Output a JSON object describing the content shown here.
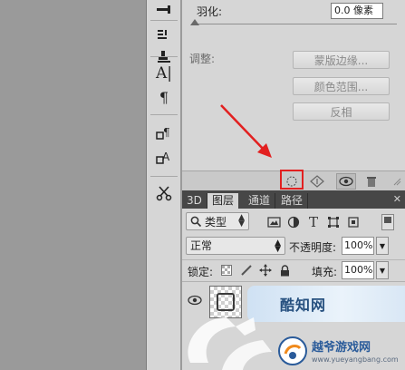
{
  "properties": {
    "feather_label": "羽化:",
    "feather_value": "0.0 像素",
    "adjust_label": "调整:",
    "buttons": [
      "蒙版边缘...",
      "颜色范围...",
      "反相"
    ]
  },
  "layers_panel": {
    "tabs": [
      "3D",
      "图层",
      "通道",
      "路径"
    ],
    "active_tab": "图层",
    "filter_type": "类型",
    "blend_mode": "正常",
    "opacity_label": "不透明度:",
    "opacity_value": "100%",
    "lock_label": "锁定:",
    "fill_label": "填充:",
    "fill_value": "100%",
    "preview_text": "酷知网"
  },
  "watermark": {
    "title": "越爷游戏网",
    "url": "www.yueyangbang.com"
  },
  "colors": {
    "panel": "#d6d6d6",
    "workarea": "#9a9a9a",
    "annotation_red": "#e22020",
    "tabs_bar": "#474747"
  }
}
